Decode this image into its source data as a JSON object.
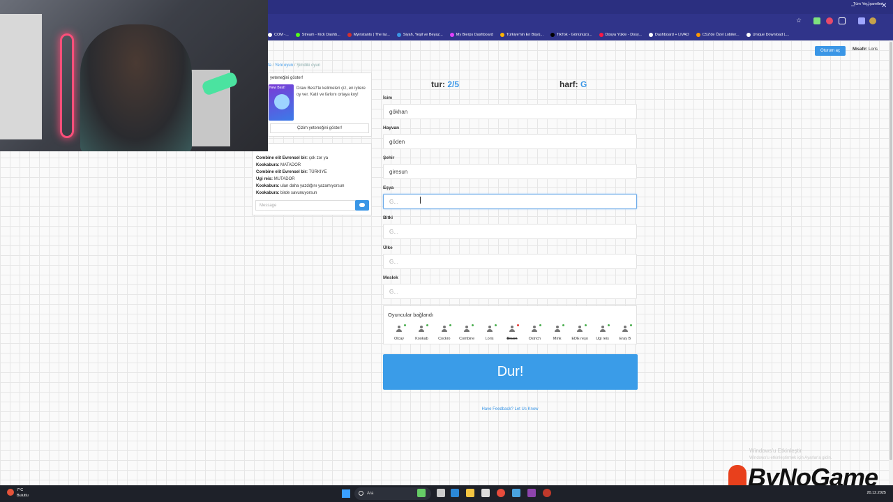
{
  "browser": {
    "bookmarks": [
      {
        "label": "COM -...",
        "color": "#ffffff"
      },
      {
        "label": "Stream - Kick Dashb...",
        "color": "#53fc18"
      },
      {
        "label": "Myinstants | The lar...",
        "color": "#d32f2f"
      },
      {
        "label": "Siyah, Yeşil ve Beyaz...",
        "color": "#3a96e6"
      },
      {
        "label": "My Bierps Dashboard",
        "color": "#e040fb"
      },
      {
        "label": "Türkiye'nin En Büyü...",
        "color": "#ffb300"
      },
      {
        "label": "TikTok - Gönünüzü...",
        "color": "#000000"
      },
      {
        "label": "Dosya Yükle - Dosy...",
        "color": "#ff1744"
      },
      {
        "label": "Dashboard + LIVAD",
        "color": "#ffffff"
      },
      {
        "label": "CS2'de Özel Lobiler...",
        "color": "#ff9800"
      },
      {
        "label": "Unique Download L...",
        "color": "#ffffff"
      }
    ],
    "all_bookmarks": "Tüm Yer İşaretleri"
  },
  "header": {
    "login_label": "Oturum aç",
    "guest_prefix": "Misafir:",
    "guest_name": "Loris"
  },
  "breadcrumb": {
    "item1": "fa",
    "item2": "Yeni oyun",
    "item3": "Şimdiki oyun"
  },
  "promo": {
    "title": "yeteneğini göster!",
    "text": "Draw Best!'te kelimeleri çiz, en iyilere oy ver. Katıl ve farkını ortaya koy!",
    "badge": "New Best!",
    "button": "Çizim yeteneğini göster!"
  },
  "chat": {
    "messages": [
      {
        "user": "Combine elit Evrensel bir:",
        "text": "çok zor ya"
      },
      {
        "user": "Kookabura:",
        "text": "MATADOR"
      },
      {
        "user": "Combine elit Evrensel bir:",
        "text": "TÜRKIYE"
      },
      {
        "user": "Ugi reis:",
        "text": "MUTADOR"
      },
      {
        "user": "Kookabura:",
        "text": "ulan daha yazdığını yazamıyorsun"
      },
      {
        "user": "Kookabura:",
        "text": "birde savunuyorsun"
      }
    ],
    "placeholder": "Message"
  },
  "game": {
    "round_label": "tur:",
    "round_value": "2/5",
    "letter_label": "harf:",
    "letter_value": "G",
    "fields": [
      {
        "label": "İsim",
        "value": "gökhan",
        "placeholder": "G..."
      },
      {
        "label": "Hayvan",
        "value": "göden",
        "placeholder": "G..."
      },
      {
        "label": "Şehir",
        "value": "giresun",
        "placeholder": "G..."
      },
      {
        "label": "Eşya",
        "value": "",
        "placeholder": "G..."
      },
      {
        "label": "Bitki",
        "value": "",
        "placeholder": "G..."
      },
      {
        "label": "Ülke",
        "value": "",
        "placeholder": "G..."
      },
      {
        "label": "Meslek",
        "value": "",
        "placeholder": "G..."
      }
    ],
    "players_title": "Oyuncular bağlandı",
    "players": [
      {
        "name": "Olcay",
        "status": "online"
      },
      {
        "name": "Kookab",
        "status": "online"
      },
      {
        "name": "Cockro",
        "status": "online"
      },
      {
        "name": "Combine",
        "status": "online"
      },
      {
        "name": "Loris",
        "status": "online"
      },
      {
        "name": "Bison",
        "status": "away"
      },
      {
        "name": "Ostrich",
        "status": "online"
      },
      {
        "name": "Mink",
        "status": "online"
      },
      {
        "name": "EDE reşo",
        "status": "online"
      },
      {
        "name": "Ugi reis",
        "status": "online"
      },
      {
        "name": "Eray B",
        "status": "online"
      }
    ],
    "stop_button": "Dur!",
    "feedback": "Have Feedback? Let Us Know"
  },
  "overlay": {
    "activate_title": "Windows'u Etkinleştir",
    "activate_sub": "Windows'u etkinleştirmek için Ayarlar'a gidin.",
    "brand": "ByNoGame"
  },
  "taskbar": {
    "weather_temp": "7°C",
    "weather_desc": "Bulutlu",
    "search_label": "Ara",
    "date": "20.12.2025"
  }
}
